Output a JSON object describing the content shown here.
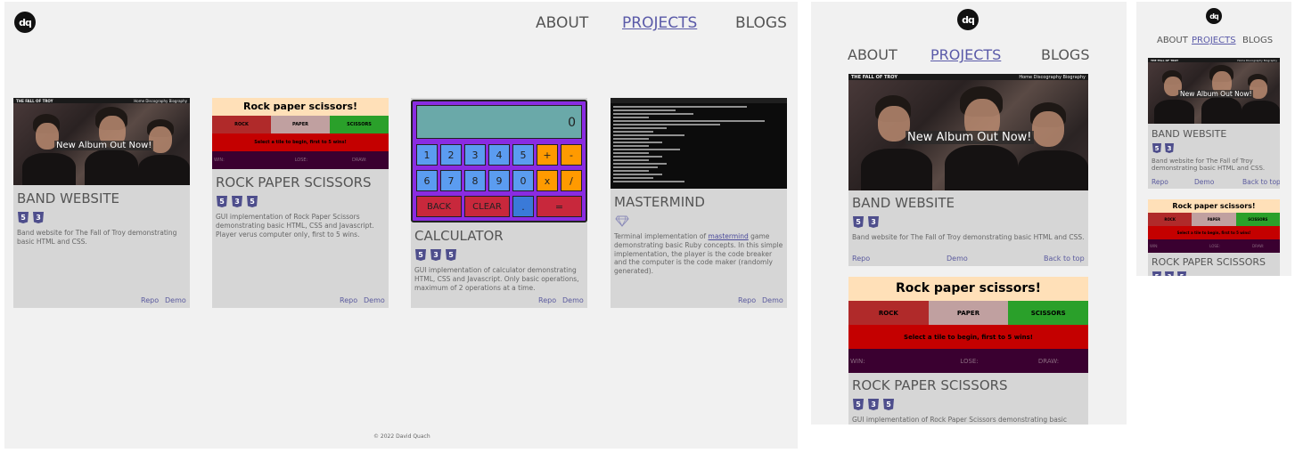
{
  "logo": "dq",
  "nav": {
    "about": "ABOUT",
    "projects": "PROJECTS",
    "blogs": "BLOGS"
  },
  "projects": {
    "band": {
      "title": "BAND WEBSITE",
      "desc": "Band website for The Fall of Troy demonstrating basic HTML and CSS.",
      "shot_site_name": "THE FALL OF TROY",
      "shot_nav": "Home   Discography   Biography",
      "shot_caption": "New Album Out Now!",
      "tech": [
        "5",
        "3"
      ]
    },
    "rps": {
      "title": "ROCK PAPER SCISSORS",
      "desc": "GUI implementation of Rock Paper Scissors demonstrating basic HTML, CSS and Javascript. Player verus computer only, first to 5 wins.",
      "game_title": "Rock paper scissors!",
      "choices": [
        "ROCK",
        "PAPER",
        "SCISSORS"
      ],
      "message": "Select a tile to begin, first to 5 wins!",
      "scores": [
        "WIN:",
        "LOSE:",
        "DRAW:"
      ],
      "tech": [
        "5",
        "3",
        "5"
      ]
    },
    "calc": {
      "title": "CALCULATOR",
      "desc": "GUI implementation of calculator demonstrating HTML, CSS and Javascript. Only basic operations, maximum of 2 operations at a time.",
      "display": "0",
      "keys_row1": [
        "1",
        "2",
        "3",
        "4",
        "5",
        "+",
        "-"
      ],
      "keys_row2": [
        "6",
        "7",
        "8",
        "9",
        "0",
        "x",
        "/"
      ],
      "keys_row3": [
        "BACK",
        "CLEAR",
        ".",
        "="
      ],
      "tech": [
        "5",
        "3",
        "5"
      ]
    },
    "mastermind": {
      "title": "MASTERMIND",
      "desc_pre": "Terminal implementation of ",
      "desc_link": "mastermind",
      "desc_post": " game demonstrating basic Ruby concepts. In this simple implementation, the player is the code breaker and the computer is the code maker (randomly generated)."
    }
  },
  "links": {
    "repo": "Repo",
    "demo": "Demo",
    "back_to_top": "Back to top"
  },
  "footer": "© 2022 David Quach",
  "colors": {
    "accent": "#5a5aa8",
    "card": "#d6d6d6",
    "page": "#f1f1f1"
  }
}
